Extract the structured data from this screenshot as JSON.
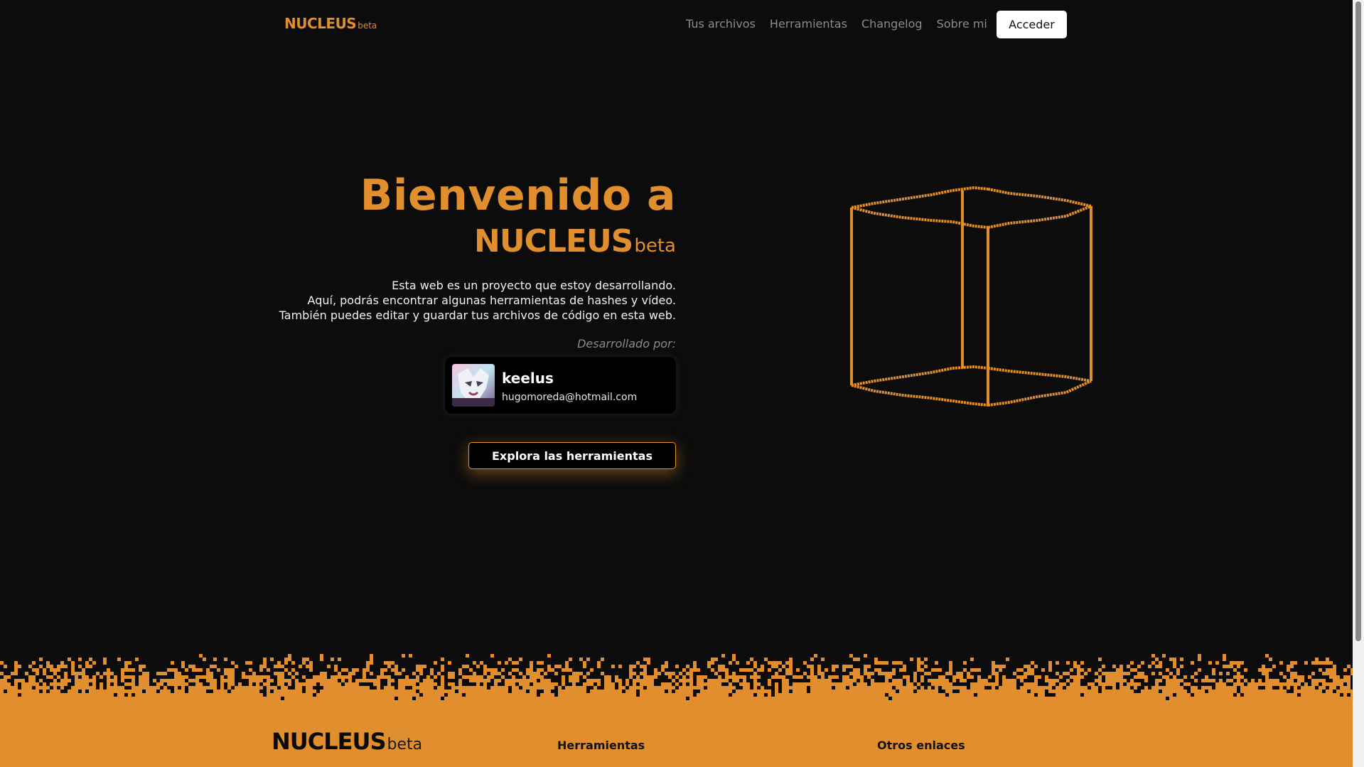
{
  "colors": {
    "accent": "#e08e2e",
    "background": "#0c0c0c",
    "footer_bg": "#e08e2e"
  },
  "nav": {
    "brand": "NUCLEUS",
    "brand_suffix": "beta",
    "links": [
      {
        "label": "Tus archivos"
      },
      {
        "label": "Herramientas"
      },
      {
        "label": "Changelog"
      },
      {
        "label": "Sobre mi"
      }
    ],
    "login_label": "Acceder"
  },
  "hero": {
    "title": "Bienvenido a",
    "brand": "NUCLEUS",
    "brand_suffix": "beta",
    "description": [
      "Esta web es un proyecto que estoy desarrollando.",
      "Aquí, podrás encontrar algunas herramientas de hashes y vídeo.",
      "También puedes editar y guardar tus archivos de código en esta web."
    ],
    "developed_by_label": "Desarrollado por:",
    "profile": {
      "name": "keelus",
      "email": "hugomoreda@hotmail.com"
    },
    "cta_label": "Explora las herramientas",
    "illustration_icon": "isometric-pixel-book-icon"
  },
  "footer": {
    "brand": "NUCLEUS",
    "brand_suffix": "beta",
    "col1_heading": "Herramientas",
    "col2_heading": "Otros enlaces"
  }
}
